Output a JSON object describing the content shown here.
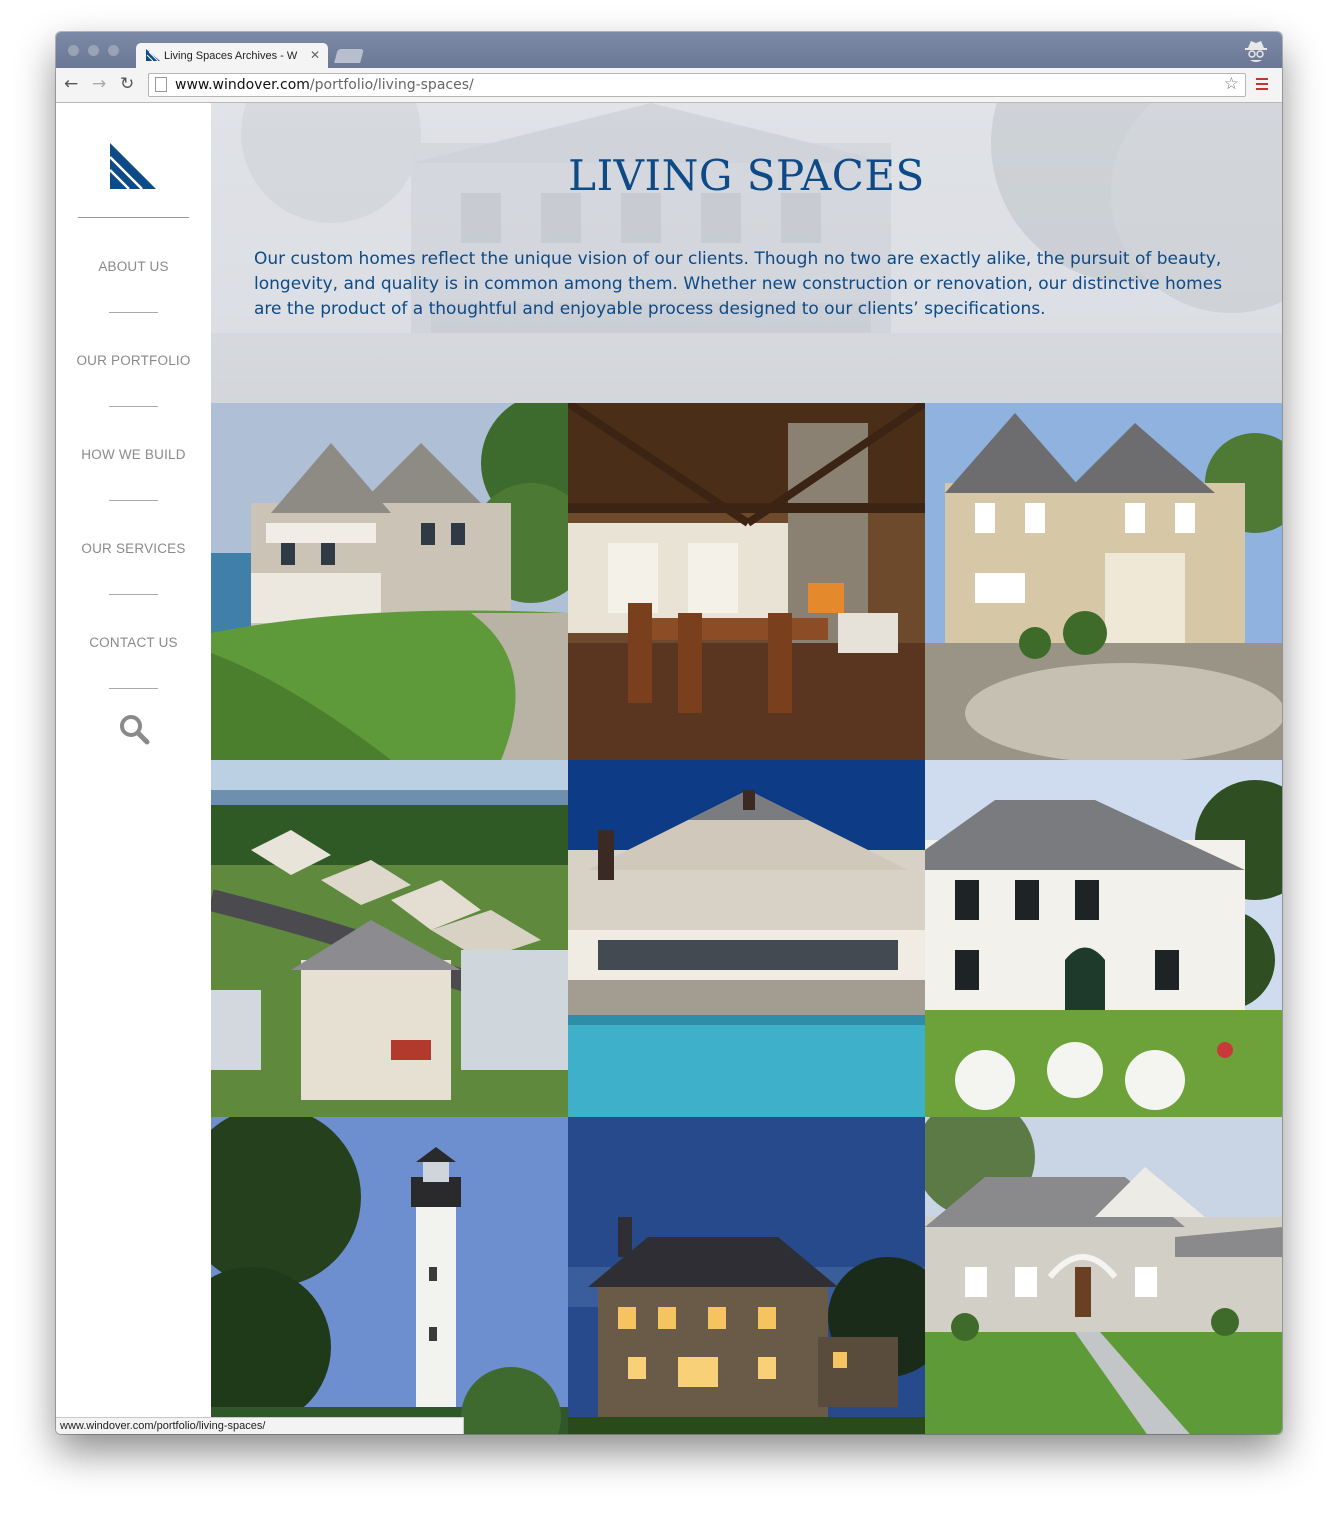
{
  "browser": {
    "tab_title": "Living Spaces Archives - W",
    "tab_close": "✕",
    "url_host": "www.windover.com",
    "url_path": "/portfolio/living-spaces/",
    "back_icon": "←",
    "forward_icon": "→",
    "reload_icon": "↻",
    "star_icon": "☆",
    "status_url": "www.windover.com/portfolio/living-spaces/"
  },
  "sidebar": {
    "logo": "windover-sail-logo",
    "items": [
      {
        "label": "ABOUT US"
      },
      {
        "label": "OUR PORTFOLIO"
      },
      {
        "label": "HOW WE BUILD"
      },
      {
        "label": "OUR SERVICES"
      },
      {
        "label": "CONTACT US"
      }
    ],
    "search_icon": "search-icon"
  },
  "hero": {
    "title": "LIVING SPACES",
    "description": "Our custom homes reflect the unique vision of our clients. Though no two are exactly alike, the pursuit of beauty, longevity, and quality is in common among them. Whether new construction or renovation, our distinctive homes are the product of a thoughtful and enjoyable process designed to our clients’ specifications."
  },
  "gallery": [
    {
      "name": "coastal-shingle-home"
    },
    {
      "name": "timber-frame-dining-room"
    },
    {
      "name": "beige-colonial-courtyard"
    },
    {
      "name": "aerial-neighborhood"
    },
    {
      "name": "pool-house"
    },
    {
      "name": "white-colonial-with-garden"
    },
    {
      "name": "lighthouse"
    },
    {
      "name": "dusk-estate"
    },
    {
      "name": "shingle-home-walkway"
    }
  ],
  "colors": {
    "brand_blue": "#0d4a86",
    "nav_gray": "#8a8a8a"
  }
}
